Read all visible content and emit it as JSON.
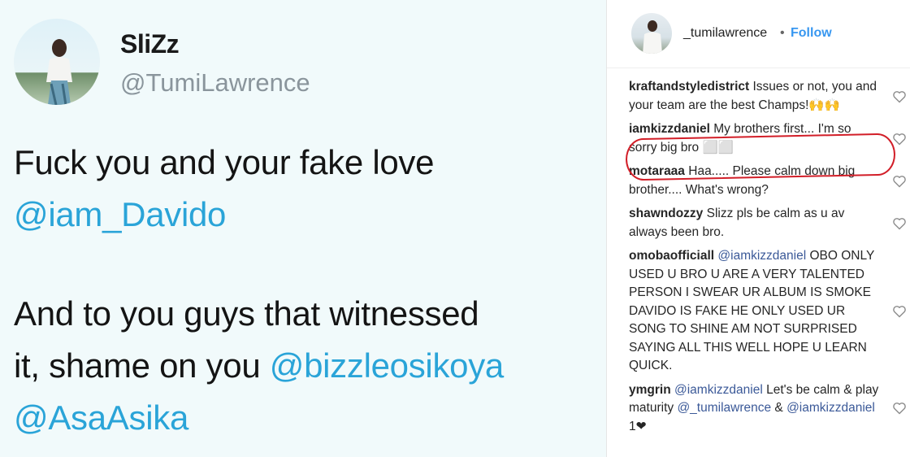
{
  "tweet": {
    "display_name": "SliZz",
    "handle": "@TumiLawrence",
    "lines": [
      {
        "text": "Fuck you and your fake love",
        "mention": ""
      },
      {
        "text": "",
        "mention": "@iam_Davido"
      },
      {
        "text": "And to you guys that witnessed",
        "mention": ""
      },
      {
        "text": "it, shame on you ",
        "mention": "@bizzleosikoya"
      },
      {
        "text": "",
        "mention": "@AsaAsika"
      }
    ]
  },
  "instagram": {
    "header": {
      "username": "_tumilawrence",
      "separator": "•",
      "follow_label": "Follow"
    },
    "comments": [
      {
        "user": "kraftandstyledistrict",
        "pre": "",
        "mention": "",
        "text": "Issues or not, you and your team are the best Champs!🙌🙌"
      },
      {
        "user": "iamkizzdaniel",
        "pre": "",
        "mention": "",
        "text": "My brothers first... I'm so sorry big bro ⬜⬜"
      },
      {
        "user": "motaraaa",
        "pre": "",
        "mention": "",
        "text": "Haa..... Please calm down big brother.... What's wrong?"
      },
      {
        "user": "shawndozzy",
        "pre": "",
        "mention": "",
        "text": "Slizz pls be calm as u av always been bro."
      },
      {
        "user": "omobaofficiall",
        "pre": "",
        "mention": "@iamkizzdaniel",
        "text": " OBO ONLY USED U BRO U ARE A VERY TALENTED PERSON I SWEAR UR ALBUM IS SMOKE DAVIDO IS FAKE HE ONLY USED UR SONG TO SHINE AM NOT SURPRISED SAYING ALL THIS WELL HOPE U LEARN QUICK."
      },
      {
        "user": "ymgrin",
        "pre": "",
        "mention": "@iamkizzdaniel",
        "text": " Let's be calm & play maturity ",
        "mention2": "@_tumilawrence",
        "text2": " & ",
        "mention3": "@iamkizzdaniel",
        "text3": " 1❤"
      }
    ]
  }
}
